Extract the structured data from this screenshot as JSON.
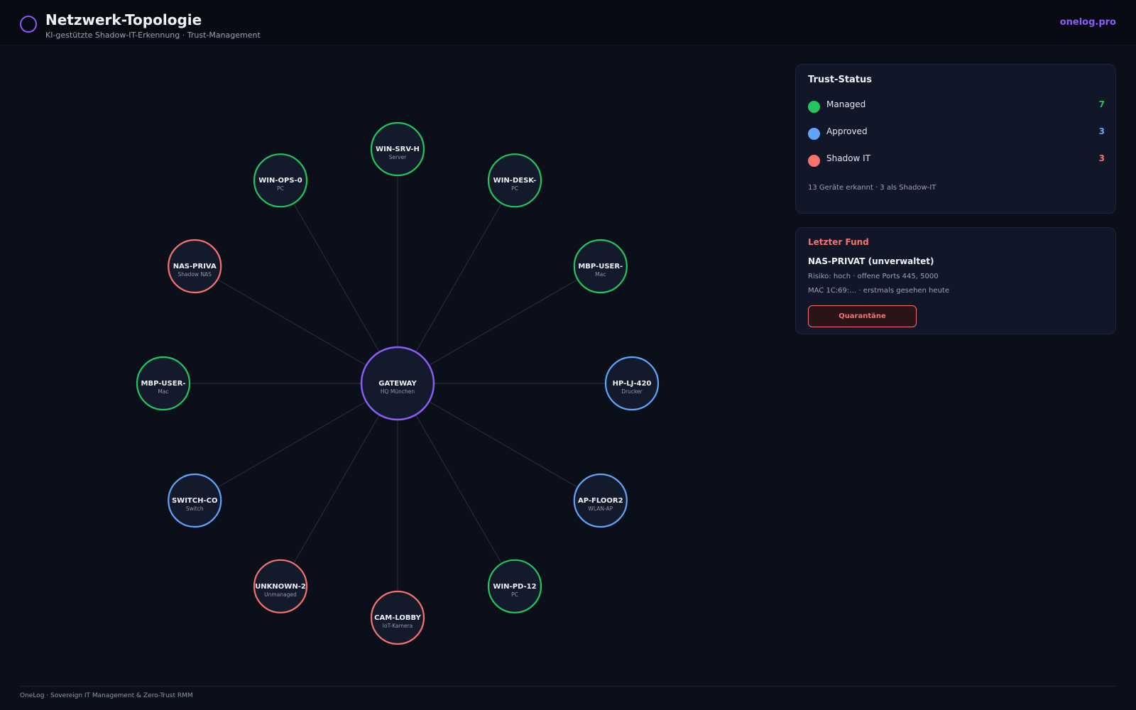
{
  "header": {
    "title": "Netzwerk-Topologie",
    "subtitle": "KI-gestützte Shadow-IT-Erkennung · Trust-Management",
    "brand": "onelog.pro",
    "logo_icon": "ring-logo-icon"
  },
  "colors": {
    "managed": "#22c55e",
    "approved": "#60a5fa",
    "shadow": "#f87171",
    "gateway": "#8b5cf6"
  },
  "topology": {
    "gateway": {
      "name": "GATEWAY",
      "type": "HQ München",
      "status": "gateway"
    },
    "nodes": [
      {
        "name": "WIN-SRV-H",
        "type": "Server",
        "status": "managed"
      },
      {
        "name": "WIN-DESK-",
        "type": "PC",
        "status": "managed"
      },
      {
        "name": "MBP-USER-",
        "type": "Mac",
        "status": "managed"
      },
      {
        "name": "HP-LJ-420",
        "type": "Drucker",
        "status": "approved"
      },
      {
        "name": "AP-FLOOR2",
        "type": "WLAN-AP",
        "status": "approved"
      },
      {
        "name": "WIN-PD-12",
        "type": "PC",
        "status": "managed"
      },
      {
        "name": "CAM-LOBBY",
        "type": "IoT-Kamera",
        "status": "shadow"
      },
      {
        "name": "UNKNOWN-2",
        "type": "Unmanaged",
        "status": "shadow"
      },
      {
        "name": "SWITCH-CO",
        "type": "Switch",
        "status": "approved"
      },
      {
        "name": "MBP-USER-",
        "type": "Mac",
        "status": "managed"
      },
      {
        "name": "NAS-PRIVA",
        "type": "Shadow NAS",
        "status": "shadow"
      },
      {
        "name": "WIN-OPS-0",
        "type": "PC",
        "status": "managed"
      }
    ]
  },
  "trust_status": {
    "title": "Trust-Status",
    "rows": [
      {
        "label": "Managed",
        "count": "7",
        "status": "managed"
      },
      {
        "label": "Approved",
        "count": "3",
        "status": "approved"
      },
      {
        "label": "Shadow IT",
        "count": "3",
        "status": "shadow"
      }
    ],
    "summary": "13 Geräte erkannt · 3 als Shadow-IT"
  },
  "latest_finding": {
    "title": "Letzter Fund",
    "device": "NAS-PRIVAT (unverwaltet)",
    "risk": "Risiko: hoch · offene Ports 445, 5000",
    "mac": "MAC 1C:69:… · erstmals gesehen heute",
    "action_label": "Quarantäne"
  },
  "footer": {
    "text": "OneLog · Sovereign IT Management & Zero-Trust RMM"
  }
}
